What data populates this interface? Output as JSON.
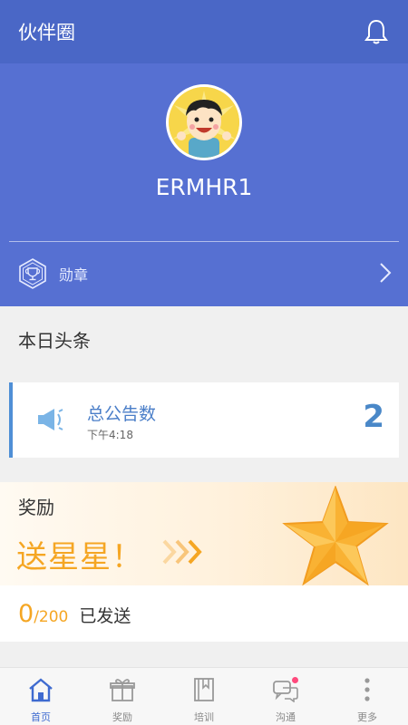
{
  "header": {
    "title": "伙伴圈",
    "bell_icon": "bell-icon"
  },
  "profile": {
    "username": "ERMHR1",
    "avatar_icon": "avatar-cartoon"
  },
  "badge_row": {
    "label": "勋章",
    "icon": "trophy-hexagon-icon",
    "chevron_icon": "chevron-right-icon"
  },
  "section": {
    "title": "本日头条"
  },
  "announcement": {
    "title": "总公告数",
    "time": "下午4:18",
    "count": "2",
    "icon": "megaphone-icon"
  },
  "reward": {
    "title": "奖励",
    "slogan": "送星星！",
    "sent": "0",
    "total": "/200",
    "status_label": "已发送",
    "accent_color": "#f5a623"
  },
  "bottom_nav": {
    "items": [
      {
        "label": "首页",
        "icon": "home-icon",
        "active": true
      },
      {
        "label": "奖励",
        "icon": "gift-icon",
        "active": false
      },
      {
        "label": "培训",
        "icon": "book-icon",
        "active": false
      },
      {
        "label": "沟通",
        "icon": "chat-icon",
        "active": false,
        "has_notification": true
      },
      {
        "label": "更多",
        "icon": "more-vertical-icon",
        "active": false
      }
    ]
  },
  "colors": {
    "header_bg": "#4a67c6",
    "profile_bg": "#5670d2",
    "active_nav": "#3f6bd0"
  }
}
